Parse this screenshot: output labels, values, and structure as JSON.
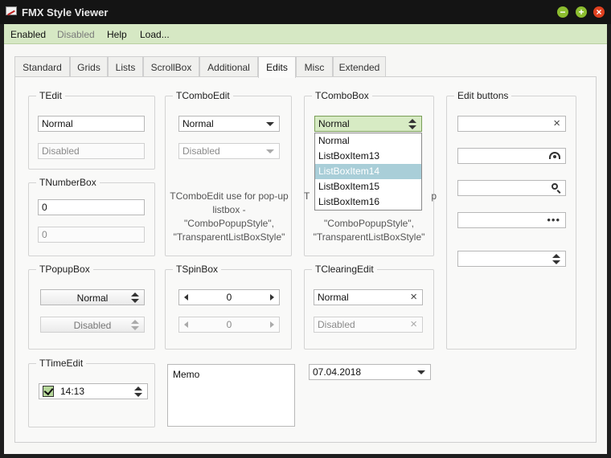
{
  "window": {
    "title": "FMX Style Viewer",
    "minimize": "−",
    "maximize": "+",
    "close": "×"
  },
  "menu": {
    "enabled": "Enabled",
    "disabled": "Disabled",
    "help": "Help",
    "load": "Load..."
  },
  "tabs": [
    "Standard",
    "Grids",
    "Lists",
    "ScrollBox",
    "Additional",
    "Edits",
    "Misc",
    "Extended"
  ],
  "active_tab": "Edits",
  "tedit": {
    "title": "TEdit",
    "normal": "Normal",
    "disabled": "Disabled"
  },
  "tcomboedit": {
    "title": "TComboEdit",
    "normal": "Normal",
    "disabled": "Disabled",
    "note": "TComboEdit use for pop-up listbox - \"ComboPopupStyle\", \"TransparentListBoxStyle\""
  },
  "tcombobox": {
    "title": "TComboBox",
    "selected": "Normal",
    "items": [
      "Normal",
      "ListBoxItem13",
      "ListBoxItem14",
      "ListBoxItem15",
      "ListBoxItem16"
    ],
    "highlighted_index": 2,
    "note_visible_prefix": "T",
    "note_visible_suffix": "p",
    "note_lines": [
      "\"ComboPopupStyle\",",
      "\"TransparentListBoxStyle\""
    ]
  },
  "edit_buttons": {
    "title": "Edit buttons",
    "icons": [
      "clear-icon",
      "password-eye-icon",
      "search-icon",
      "ellipsis-icon",
      "spin-icon"
    ]
  },
  "tnumberbox": {
    "title": "TNumberBox",
    "value": "0",
    "disabled_value": "0"
  },
  "tpopupbox": {
    "title": "TPopupBox",
    "normal": "Normal",
    "disabled": "Disabled"
  },
  "tspinbox": {
    "title": "TSpinBox",
    "value": "0",
    "disabled_value": "0"
  },
  "tclearingedit": {
    "title": "TClearingEdit",
    "normal": "Normal",
    "disabled": "Disabled"
  },
  "ttimeedit": {
    "title": "TTimeEdit",
    "checked": true,
    "value": "14:13"
  },
  "memo": {
    "text": "Memo"
  },
  "dateedit": {
    "value": "07.04.2018"
  },
  "colors": {
    "menubar": "#d6e8c4",
    "accent": "#8cbd2f",
    "close": "#e0401f",
    "list_selection": "#a9ced8"
  }
}
